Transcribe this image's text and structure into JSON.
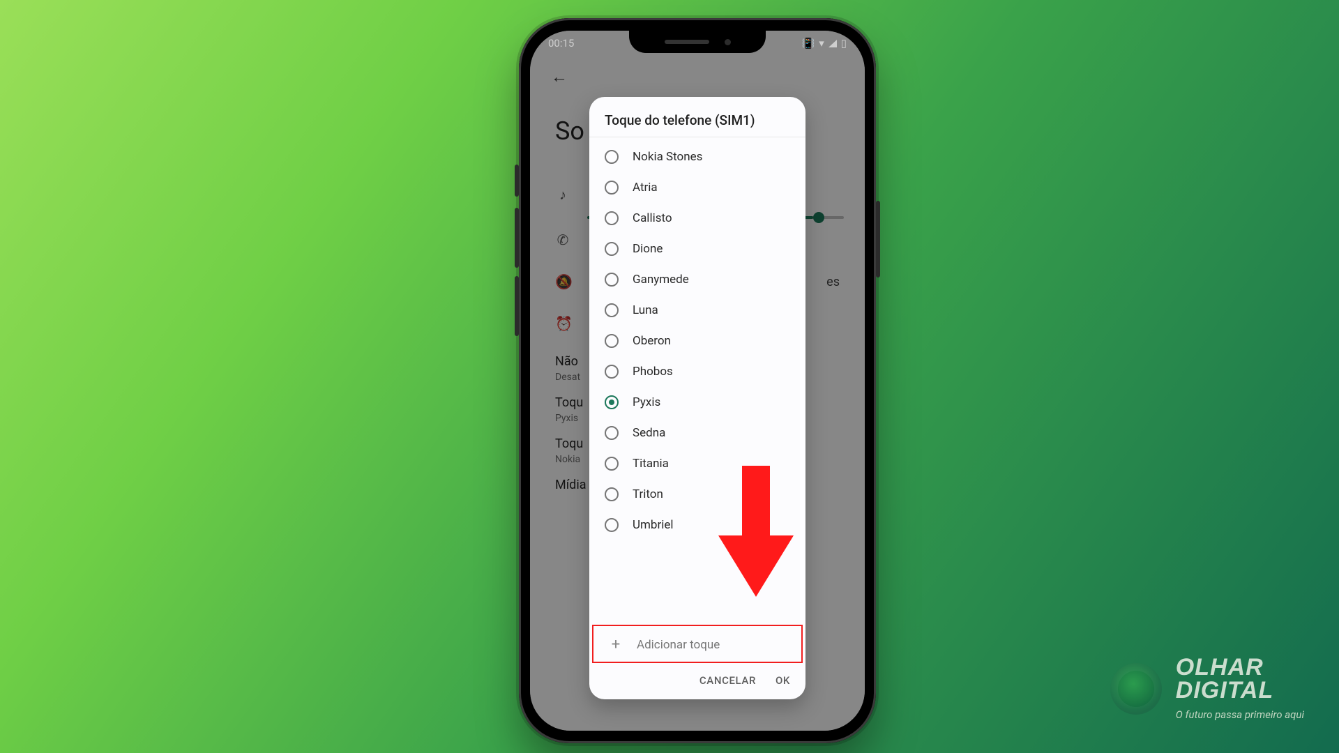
{
  "statusbar": {
    "time": "00:15"
  },
  "page": {
    "title_fragment": "So",
    "entries": {
      "nao_label": "Não",
      "nao_sub": "Desat",
      "toque1_label": "Toqu",
      "toque1_sub": "Pyxis",
      "toque2_label": "Toqu",
      "toque2_sub": "Nokia",
      "midia_label": "Mídia",
      "right_text": "es"
    }
  },
  "dialog": {
    "title": "Toque do telefone (SIM1)",
    "ringtones": [
      {
        "label": "Nokia Stones",
        "selected": false
      },
      {
        "label": "Atria",
        "selected": false
      },
      {
        "label": "Callisto",
        "selected": false
      },
      {
        "label": "Dione",
        "selected": false
      },
      {
        "label": "Ganymede",
        "selected": false
      },
      {
        "label": "Luna",
        "selected": false
      },
      {
        "label": "Oberon",
        "selected": false
      },
      {
        "label": "Phobos",
        "selected": false
      },
      {
        "label": "Pyxis",
        "selected": true
      },
      {
        "label": "Sedna",
        "selected": false
      },
      {
        "label": "Titania",
        "selected": false
      },
      {
        "label": "Triton",
        "selected": false
      },
      {
        "label": "Umbriel",
        "selected": false
      }
    ],
    "add_label": "Adicionar toque",
    "cancel": "CANCELAR",
    "ok": "OK"
  },
  "brand": {
    "line1": "OLHAR",
    "line2": "DIGITAL",
    "tagline": "O futuro passa primeiro aqui"
  },
  "annotation": {
    "arrow_color": "#ff1a1a"
  }
}
